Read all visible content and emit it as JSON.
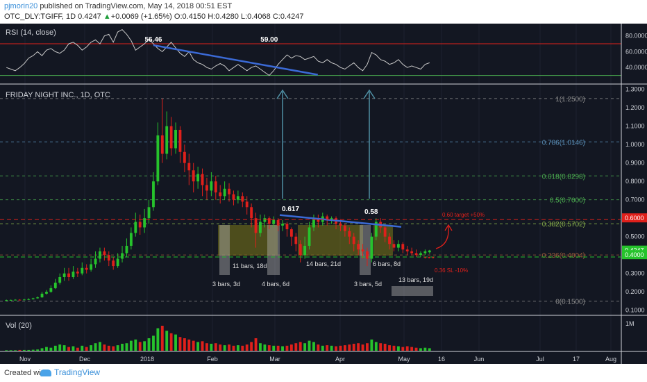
{
  "header": {
    "author": "pjmorin20",
    "published": " published on TradingView.com, May 14, 2018 00:51 EST",
    "symbol": "OTC_DLY:TGIFF, 1D",
    "last": "0.4247",
    "change": "+0.0069 (+1.65%)",
    "open": "O:0.4150",
    "high": "H:0.4280",
    "low": "L:0.4068",
    "close": "C:0.4247"
  },
  "footer": {
    "created": "Created with",
    "brand": "TradingView"
  },
  "colors": {
    "background": "#131722",
    "panel_border": "#d0d3d9",
    "grid": "#2a2e39",
    "up": "#26c32c",
    "down": "#e0201b",
    "rsi_line": "#c8c8c8",
    "trend": "#3b6ad6",
    "arrow": "#4f8fa3",
    "fib": "#4caf50",
    "target_line": "#e0201b",
    "box_fill": "#7d7a18",
    "bar_box": "#b0b0b0"
  },
  "chart_data": [
    {
      "panel": "rsi",
      "type": "line",
      "title": "RSI (14, close)",
      "ylim": [
        20,
        92
      ],
      "yticks": [
        "80.0000",
        "60.0000",
        "40.0000"
      ],
      "levels": [
        70,
        30
      ],
      "values": [
        40,
        38,
        36,
        40,
        45,
        52,
        55,
        60,
        55,
        62,
        64,
        60,
        58,
        62,
        70,
        72,
        68,
        62,
        66,
        72,
        75,
        70,
        80,
        82,
        72,
        85,
        88,
        82,
        74,
        62,
        66,
        70,
        76,
        70,
        64,
        60,
        66,
        72,
        65,
        58,
        54,
        60,
        50,
        46,
        44,
        40,
        38,
        42,
        45,
        42,
        36,
        40,
        44,
        40,
        36,
        40,
        42,
        38,
        34,
        30,
        36,
        44,
        50,
        56,
        52,
        55,
        54,
        50,
        52,
        54,
        48,
        46,
        50,
        46,
        44,
        40,
        38,
        42,
        46,
        40,
        36,
        44,
        59,
        56,
        50,
        48,
        44,
        46,
        50,
        44,
        40,
        42,
        40,
        38,
        44,
        46
      ],
      "annotations": [
        {
          "label": "56.46",
          "at": 33
        },
        {
          "label": "59.00",
          "at": 59
        }
      ]
    },
    {
      "panel": "price",
      "type": "candlestick",
      "title": "FRIDAY NIGHT INC., 1D, OTC",
      "ylim": [
        0.08,
        1.31
      ],
      "yticks": [
        "1.3000",
        "1.2000",
        "1.1000",
        "1.0000",
        "0.9000",
        "0.8000",
        "0.7000",
        "0.6000",
        "0.5000",
        "0.4000",
        "0.3000",
        "0.2000",
        "0.1000"
      ],
      "x_labels": [
        "Nov",
        "Dec",
        "2018",
        "Feb",
        "Mar",
        "Apr",
        "May",
        "16",
        "Jun",
        "Jul",
        "17",
        "Aug"
      ],
      "candles": [
        [
          0.155,
          0.155,
          0.152,
          0.158
        ],
        [
          0.155,
          0.156,
          0.152,
          0.158
        ],
        [
          0.156,
          0.157,
          0.154,
          0.16
        ],
        [
          0.157,
          0.156,
          0.154,
          0.16
        ],
        [
          0.156,
          0.158,
          0.155,
          0.162
        ],
        [
          0.158,
          0.16,
          0.156,
          0.165
        ],
        [
          0.16,
          0.165,
          0.158,
          0.168
        ],
        [
          0.165,
          0.17,
          0.163,
          0.175
        ],
        [
          0.17,
          0.19,
          0.168,
          0.2
        ],
        [
          0.19,
          0.2,
          0.185,
          0.21
        ],
        [
          0.2,
          0.22,
          0.195,
          0.235
        ],
        [
          0.22,
          0.25,
          0.215,
          0.27
        ],
        [
          0.25,
          0.28,
          0.24,
          0.3
        ],
        [
          0.28,
          0.3,
          0.26,
          0.33
        ],
        [
          0.3,
          0.28,
          0.26,
          0.33
        ],
        [
          0.28,
          0.31,
          0.27,
          0.34
        ],
        [
          0.31,
          0.3,
          0.28,
          0.33
        ],
        [
          0.3,
          0.33,
          0.29,
          0.36
        ],
        [
          0.33,
          0.32,
          0.3,
          0.35
        ],
        [
          0.32,
          0.35,
          0.31,
          0.38
        ],
        [
          0.35,
          0.38,
          0.33,
          0.42
        ],
        [
          0.38,
          0.42,
          0.36,
          0.44
        ],
        [
          0.42,
          0.4,
          0.37,
          0.44
        ],
        [
          0.4,
          0.37,
          0.34,
          0.42
        ],
        [
          0.37,
          0.34,
          0.32,
          0.39
        ],
        [
          0.34,
          0.38,
          0.33,
          0.41
        ],
        [
          0.38,
          0.41,
          0.36,
          0.45
        ],
        [
          0.41,
          0.45,
          0.39,
          0.49
        ],
        [
          0.45,
          0.52,
          0.43,
          0.55
        ],
        [
          0.52,
          0.58,
          0.5,
          0.63
        ],
        [
          0.58,
          0.55,
          0.51,
          0.62
        ],
        [
          0.55,
          0.6,
          0.52,
          0.65
        ],
        [
          0.6,
          0.66,
          0.57,
          0.7
        ],
        [
          0.66,
          0.8,
          0.64,
          0.85
        ],
        [
          0.8,
          1.05,
          0.78,
          1.12
        ],
        [
          1.05,
          0.95,
          0.9,
          1.25
        ],
        [
          0.95,
          1.1,
          0.92,
          1.18
        ],
        [
          1.1,
          0.98,
          0.94,
          1.15
        ],
        [
          0.98,
          1.08,
          0.95,
          1.12
        ],
        [
          1.08,
          0.96,
          0.9,
          1.1
        ],
        [
          0.96,
          0.9,
          0.85,
          1.0
        ],
        [
          0.9,
          0.86,
          0.78,
          0.95
        ],
        [
          0.86,
          0.8,
          0.74,
          0.9
        ],
        [
          0.8,
          0.84,
          0.76,
          0.88
        ],
        [
          0.84,
          0.78,
          0.72,
          0.87
        ],
        [
          0.78,
          0.75,
          0.7,
          0.82
        ],
        [
          0.75,
          0.8,
          0.72,
          0.85
        ],
        [
          0.8,
          0.74,
          0.7,
          0.83
        ],
        [
          0.74,
          0.72,
          0.68,
          0.78
        ],
        [
          0.72,
          0.76,
          0.7,
          0.8
        ],
        [
          0.76,
          0.73,
          0.69,
          0.79
        ],
        [
          0.73,
          0.7,
          0.67,
          0.75
        ],
        [
          0.7,
          0.72,
          0.68,
          0.75
        ],
        [
          0.72,
          0.69,
          0.66,
          0.74
        ],
        [
          0.69,
          0.66,
          0.62,
          0.72
        ],
        [
          0.66,
          0.6,
          0.55,
          0.68
        ],
        [
          0.6,
          0.52,
          0.44,
          0.63
        ],
        [
          0.52,
          0.58,
          0.5,
          0.62
        ],
        [
          0.58,
          0.6,
          0.55,
          0.62
        ],
        [
          0.6,
          0.57,
          0.54,
          0.61
        ],
        [
          0.57,
          0.59,
          0.55,
          0.61
        ],
        [
          0.59,
          0.56,
          0.53,
          0.6
        ],
        [
          0.56,
          0.57,
          0.53,
          0.59
        ],
        [
          0.57,
          0.54,
          0.5,
          0.58
        ],
        [
          0.54,
          0.5,
          0.45,
          0.55
        ],
        [
          0.5,
          0.46,
          0.42,
          0.52
        ],
        [
          0.46,
          0.4,
          0.36,
          0.48
        ],
        [
          0.4,
          0.45,
          0.38,
          0.5
        ],
        [
          0.45,
          0.55,
          0.43,
          0.58
        ],
        [
          0.55,
          0.6,
          0.53,
          0.62
        ],
        [
          0.6,
          0.58,
          0.55,
          0.62
        ],
        [
          0.58,
          0.61,
          0.56,
          0.63
        ],
        [
          0.61,
          0.59,
          0.56,
          0.62
        ],
        [
          0.59,
          0.6,
          0.57,
          0.61
        ],
        [
          0.6,
          0.57,
          0.54,
          0.61
        ],
        [
          0.57,
          0.56,
          0.53,
          0.59
        ],
        [
          0.56,
          0.53,
          0.5,
          0.57
        ],
        [
          0.53,
          0.5,
          0.46,
          0.55
        ],
        [
          0.5,
          0.46,
          0.42,
          0.52
        ],
        [
          0.46,
          0.43,
          0.4,
          0.48
        ],
        [
          0.43,
          0.42,
          0.38,
          0.46
        ],
        [
          0.42,
          0.38,
          0.34,
          0.44
        ],
        [
          0.38,
          0.5,
          0.36,
          0.52
        ],
        [
          0.5,
          0.58,
          0.48,
          0.6
        ],
        [
          0.58,
          0.55,
          0.52,
          0.6
        ],
        [
          0.55,
          0.5,
          0.47,
          0.56
        ],
        [
          0.5,
          0.46,
          0.43,
          0.52
        ],
        [
          0.46,
          0.44,
          0.42,
          0.48
        ],
        [
          0.44,
          0.46,
          0.42,
          0.48
        ],
        [
          0.46,
          0.43,
          0.41,
          0.47
        ],
        [
          0.43,
          0.42,
          0.4,
          0.45
        ],
        [
          0.42,
          0.41,
          0.4,
          0.44
        ],
        [
          0.41,
          0.4,
          0.39,
          0.43
        ],
        [
          0.4,
          0.41,
          0.39,
          0.42
        ],
        [
          0.41,
          0.42,
          0.4,
          0.43
        ],
        [
          0.415,
          0.4247,
          0.4068,
          0.428
        ]
      ],
      "levels": [
        {
          "price": 1.25,
          "label": "1(1.2500)",
          "color": "#8c8c8c"
        },
        {
          "price": 1.0146,
          "label": "0.786(1.0146)",
          "color": "#5a8fb8"
        },
        {
          "price": 0.8298,
          "label": "0.618(0.8298)",
          "color": "#4caf50"
        },
        {
          "price": 0.7,
          "label": "0.5(0.7000)",
          "color": "#4caf50"
        },
        {
          "price": 0.5702,
          "label": "0.382(0.5702)",
          "color": "#8ab34a"
        },
        {
          "price": 0.4,
          "label": "0.236(0.4004)",
          "color": "#9b5a3a"
        },
        {
          "price": 0.15,
          "label": "0(0.1500)",
          "color": "#8c8c8c"
        }
      ],
      "price_tags": [
        {
          "label": "0.6000",
          "bg": "#e0201b"
        },
        {
          "label": "0.4247",
          "bg": "#26c32c"
        },
        {
          "label": "0.4000",
          "bg": "#26c32c"
        }
      ],
      "annotations": {
        "peak_1": "0.617",
        "peak_2": "0.58",
        "target": "0.60 target +50%",
        "stop": "0.36 SL -10%",
        "bars": [
          "11 bars, 18d",
          "14 bars, 21d",
          "6 bars, 8d",
          "3 bars, 3d",
          "4 bars, 6d",
          "3 bars, 5d",
          "13 bars, 19d"
        ]
      }
    },
    {
      "panel": "volume",
      "type": "bar",
      "title": "Vol (20)",
      "ytick": "1M",
      "values": [
        0.02,
        0.02,
        0.02,
        0.03,
        0.03,
        0.03,
        0.04,
        0.05,
        0.1,
        0.15,
        0.12,
        0.2,
        0.25,
        0.22,
        0.15,
        0.18,
        0.12,
        0.2,
        0.15,
        0.22,
        0.3,
        0.35,
        0.25,
        0.2,
        0.18,
        0.22,
        0.28,
        0.3,
        0.4,
        0.45,
        0.35,
        0.38,
        0.5,
        0.6,
        0.9,
        1.0,
        0.8,
        0.7,
        0.65,
        0.55,
        0.5,
        0.45,
        0.4,
        0.35,
        0.38,
        0.3,
        0.28,
        0.3,
        0.25,
        0.22,
        0.25,
        0.2,
        0.22,
        0.2,
        0.25,
        0.35,
        0.5,
        0.3,
        0.25,
        0.22,
        0.2,
        0.2,
        0.18,
        0.2,
        0.25,
        0.3,
        0.35,
        0.3,
        0.4,
        0.35,
        0.25,
        0.2,
        0.22,
        0.2,
        0.18,
        0.2,
        0.22,
        0.25,
        0.28,
        0.3,
        0.25,
        0.3,
        0.45,
        0.35,
        0.3,
        0.28,
        0.22,
        0.2,
        0.18,
        0.15,
        0.18,
        0.15,
        0.12,
        0.1,
        0.12,
        0.1
      ]
    }
  ]
}
